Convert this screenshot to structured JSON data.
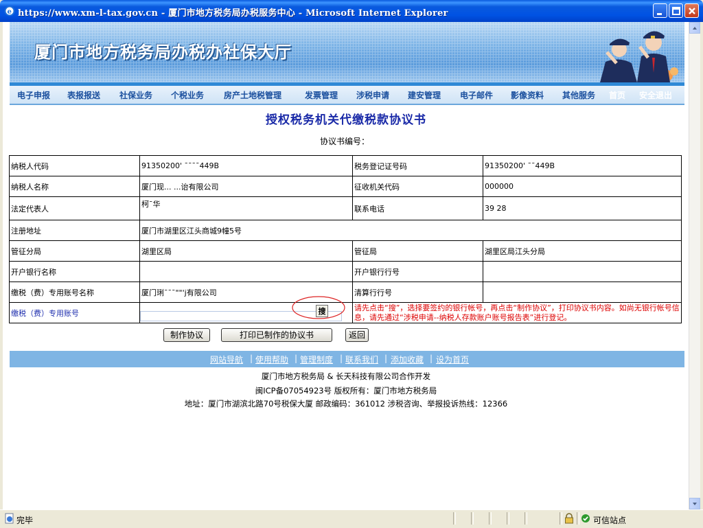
{
  "window": {
    "title": "https://www.xm-l-tax.gov.cn - 厦门市地方税务局办税服务中心 - Microsoft Internet Explorer"
  },
  "banner": {
    "title": "厦门市地方税务局办税办社保大厅"
  },
  "nav": {
    "items": [
      "电子申报",
      "表报报送",
      "社保业务",
      "个税业务",
      "房产土地税管理",
      "发票管理",
      "涉税申请",
      "建安管理",
      "电子邮件",
      "影像资料",
      "其他服务",
      "首页",
      "安全退出"
    ]
  },
  "doc": {
    "title": "授权税务机关代缴税款协议书",
    "protocol_no_label": "协议书编号："
  },
  "form": {
    "taxpayer_code_label": "纳税人代码",
    "taxpayer_code": "91350200'  ˉˉˉˉ449B",
    "tax_reg_no_label": "税务登记证号码",
    "tax_reg_no": "91350200'    ˉˉ449B",
    "taxpayer_name_label": "纳税人名称",
    "taxpayer_name": "厦门现... ...诒有限公司",
    "collector_code_label": "征收机关代码",
    "collector_code": "000000",
    "legal_rep_label": "法定代表人",
    "legal_rep": "柯ˉ华",
    "phone_label": "联系电话",
    "phone": "39    28",
    "reg_address_label": "注册地址",
    "reg_address": "厦门市湖里区江头商城9幢5号",
    "branch_label": "管征分局",
    "branch": "湖里区局",
    "bureau_label": "管征局",
    "bureau": "湖里区局江头分局",
    "bank_name_label": "开户银行名称",
    "bank_name": "",
    "bank_code_label": "开户银行行号",
    "bank_code": "",
    "account_name_label": "缴税（费）专用账号名称",
    "account_name": "厦门琍ˉˉˉ\"\"'j有限公司",
    "clearing_code_label": "清算行行号",
    "clearing_code": "",
    "account_label": "缴税（费）专用账号",
    "account_value": "",
    "search_label": "搜",
    "hint": "请先点击“搜”，选择要签约的银行帐号，再点击“制作协议”，打印协议书内容。如尚无银行帐号信息，请先通过“涉税申请--纳税人存款账户账号报告表”进行登记。"
  },
  "buttons": {
    "make": "制作协议",
    "print": "打印已制作的协议书",
    "back": "返回"
  },
  "footer": {
    "links": [
      "网站导航",
      "使用帮助",
      "管理制度",
      "联系我们",
      "添加收藏",
      "设为首页"
    ],
    "line1": "厦门市地方税务局 & 长天科技有限公司合作开发",
    "line2": "闽ICP备07054923号   版权所有：厦门市地方税务局",
    "line3": "地址：厦门市湖滨北路70号税保大厦      邮政编码：361012      涉税咨询、举报投诉热线：12366"
  },
  "status": {
    "text": "完毕",
    "zone": "可信站点"
  },
  "colors": {
    "titlebar": "#0a5ade",
    "nav_text": "#1a4f9e",
    "doc_title": "#1a2aa8",
    "hint": "#dd0000",
    "footer_bar": "#7fb5e4"
  }
}
